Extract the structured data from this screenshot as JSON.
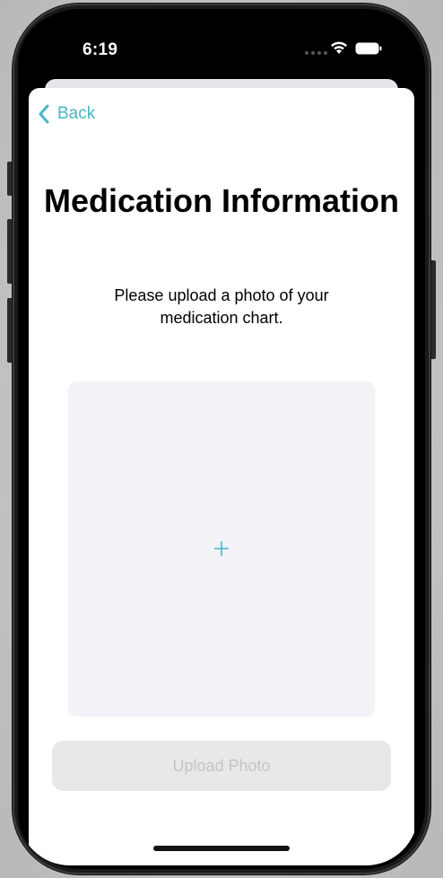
{
  "status_bar": {
    "time": "6:19"
  },
  "nav": {
    "back_label": "Back"
  },
  "content": {
    "title": "Medication Information",
    "subtitle": "Please upload a photo of your medication chart."
  },
  "photo_picker": {
    "icon": "plus-icon"
  },
  "actions": {
    "upload_label": "Upload Photo"
  },
  "colors": {
    "accent": "#4ab6c4",
    "drop_area": "#f2f2f7",
    "disabled_button_bg": "#e8e8ea",
    "disabled_button_text": "#c4c4c6"
  }
}
